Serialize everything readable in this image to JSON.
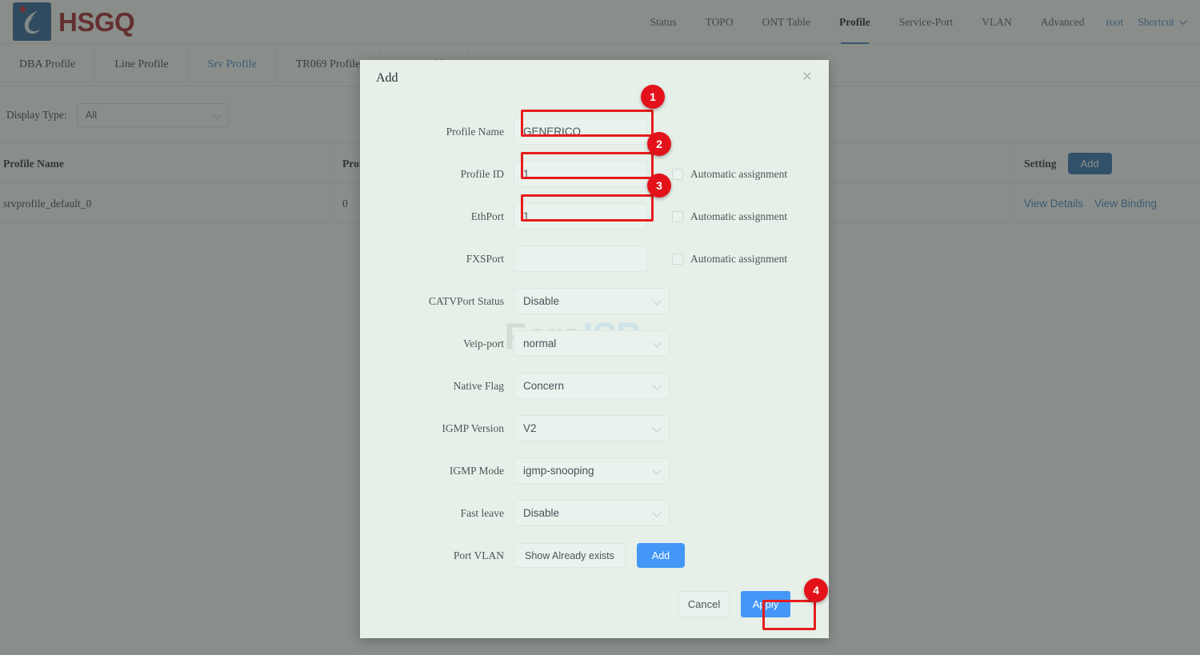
{
  "app": {
    "brand": "HSGQ",
    "logo_icon": "hsgq-droplet-logo"
  },
  "top_nav": {
    "items": [
      {
        "label": "Status",
        "active": false
      },
      {
        "label": "TOPO",
        "active": false
      },
      {
        "label": "ONT Table",
        "active": false
      },
      {
        "label": "Profile",
        "active": true
      },
      {
        "label": "Service-Port",
        "active": false
      },
      {
        "label": "VLAN",
        "active": false
      },
      {
        "label": "Advanced",
        "active": false
      }
    ],
    "user": "root",
    "shortcut": "Shortcut",
    "shortcut_icon": "chevron-down-icon"
  },
  "tabs": [
    {
      "label": "DBA Profile",
      "active": false
    },
    {
      "label": "Line Profile",
      "active": false
    },
    {
      "label": "Srv Profile",
      "active": true
    },
    {
      "label": "TR069 Profile",
      "active": false
    },
    {
      "label": "SIP Profile",
      "active": false
    }
  ],
  "filter": {
    "label": "Display Type:",
    "value": "All",
    "chevron_icon": "chevron-down-icon"
  },
  "table": {
    "columns": [
      "Profile Name",
      "Profile ID",
      "Setting"
    ],
    "add_label": "Add",
    "rows": [
      {
        "profile_name": "srvprofile_default_0",
        "profile_id": "0",
        "action_details": "View Details",
        "action_binding": "View Binding"
      }
    ]
  },
  "modal": {
    "title": "Add",
    "close_icon": "close-icon",
    "watermark": {
      "part1": "Foro",
      "part2": "ISP"
    },
    "fields": {
      "profile_name": {
        "label": "Profile Name",
        "value": "GENERICO"
      },
      "profile_id": {
        "label": "Profile ID",
        "value": "1",
        "auto": "Automatic assignment"
      },
      "ethport": {
        "label": "EthPort",
        "value": "1",
        "auto": "Automatic assignment"
      },
      "fxsport": {
        "label": "FXSPort",
        "value": "",
        "auto": "Automatic assignment"
      },
      "catvport_status": {
        "label": "CATVPort Status",
        "value": "Disable"
      },
      "veip_port": {
        "label": "Veip-port",
        "value": "normal"
      },
      "native_flag": {
        "label": "Native Flag",
        "value": "Concern"
      },
      "igmp_version": {
        "label": "IGMP Version",
        "value": "V2"
      },
      "igmp_mode": {
        "label": "IGMP Mode",
        "value": "igmp-snooping"
      },
      "fast_leave": {
        "label": "Fast leave",
        "value": "Disable"
      },
      "port_vlan": {
        "label": "Port VLAN",
        "show_label": "Show Already exists",
        "add_label": "Add"
      }
    },
    "footer": {
      "cancel": "Cancel",
      "apply": "Apply"
    }
  },
  "annotations": {
    "badges": [
      {
        "number": "1",
        "target": "profile-name-input"
      },
      {
        "number": "2",
        "target": "profile-id-input"
      },
      {
        "number": "3",
        "target": "ethport-input"
      },
      {
        "number": "4",
        "target": "apply-button"
      }
    ],
    "color": "#e3121a"
  }
}
